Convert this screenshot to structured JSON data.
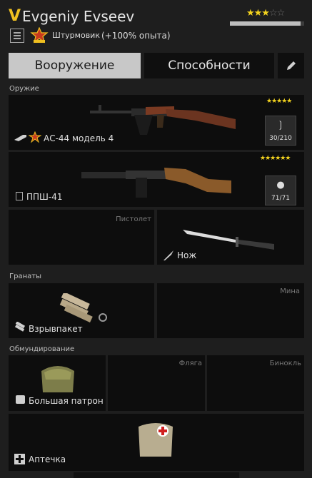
{
  "soldier": {
    "rank_letter": "V",
    "name": "Evgeniy Evseev",
    "stars": "★★★",
    "stars_off": "☆☆",
    "health_fraction": 0.95,
    "class": "Штурмовик",
    "exp_bonus": "(+100% опыта)"
  },
  "tabs": {
    "weapons": "Вооружение",
    "abilities": "Способности"
  },
  "sections": {
    "weapons": "Оружие",
    "grenades": "Гранаты",
    "equipment": "Обмундирование"
  },
  "primary": {
    "name": "АС-44 модель 4",
    "quality": "★★★★★",
    "ammo": "30/210",
    "ammo_icon": "curved-magazine-icon"
  },
  "secondary": {
    "name": "ППШ-41",
    "quality": "★★★★★★",
    "ammo": "71/71",
    "ammo_icon": "drum-magazine-icon"
  },
  "sidearm": {
    "hint": "Пистолет"
  },
  "melee": {
    "name": "Нож"
  },
  "grenade": {
    "name": "Взрывпакет"
  },
  "mine": {
    "hint": "Мина"
  },
  "backpack": {
    "name": "Большая патрон"
  },
  "flask": {
    "hint": "Фляга"
  },
  "binocular": {
    "hint": "Бинокль"
  },
  "medkit": {
    "name": "Аптечка"
  },
  "colors": {
    "accent": "#f0c020",
    "slot_bg": "#0d0d0d",
    "page_bg": "#1e1e1e",
    "tab_active": "#c8c8c8"
  }
}
